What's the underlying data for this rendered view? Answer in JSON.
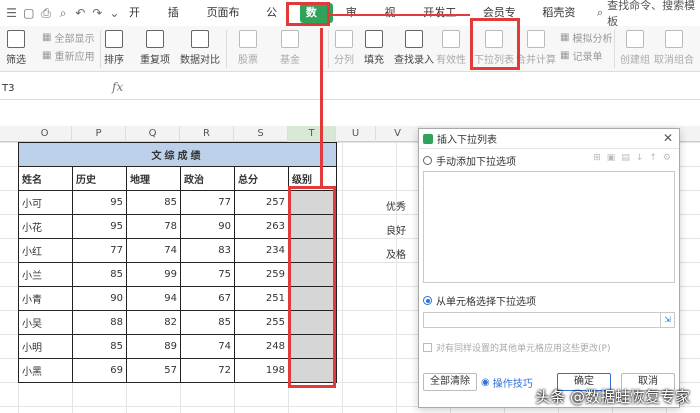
{
  "menu": {
    "tabs": [
      "开始",
      "插入",
      "页面布局",
      "公式",
      "数据",
      "审阅",
      "视图",
      "开发工具",
      "会员专享",
      "稻壳资源"
    ],
    "active_tab": "数据",
    "search": "查找命令、搜索模板"
  },
  "toolbar": {
    "show_all": "全部显示",
    "filter": "筛选",
    "reapply": "重新应用",
    "sort": "排序",
    "duplicate": "重复项",
    "compare": "数据对比",
    "stock": "股票",
    "fund": "基金",
    "split": "分列",
    "fill": "填充",
    "lookup": "查找录入",
    "validity": "有效性",
    "dropdown": "下拉列表",
    "consolidate": "合并计算",
    "simulate": "模拟分析",
    "record": "记录单",
    "group": "创建组",
    "ungroup": "取消组合"
  },
  "formula_bar": {
    "name_box": "T3",
    "fx": "fx"
  },
  "columns": [
    "O",
    "P",
    "Q",
    "R",
    "S",
    "T",
    "U",
    "V"
  ],
  "selected_column": "T",
  "table": {
    "title": "文综成绩",
    "headers": [
      "姓名",
      "历史",
      "地理",
      "政治",
      "总分",
      "级别"
    ],
    "rows": [
      [
        "小可",
        "95",
        "85",
        "77",
        "257"
      ],
      [
        "小花",
        "95",
        "78",
        "90",
        "263"
      ],
      [
        "小红",
        "77",
        "74",
        "83",
        "234"
      ],
      [
        "小兰",
        "85",
        "99",
        "75",
        "259"
      ],
      [
        "小青",
        "90",
        "94",
        "67",
        "251"
      ],
      [
        "小吴",
        "88",
        "82",
        "85",
        "255"
      ],
      [
        "小明",
        "85",
        "89",
        "74",
        "248"
      ],
      [
        "小黑",
        "69",
        "57",
        "72",
        "198"
      ]
    ]
  },
  "side_labels": [
    "优秀",
    "良好",
    "及格"
  ],
  "dialog": {
    "title": "插入下拉列表",
    "option_manual": "手动添加下拉选项",
    "option_cells": "从单元格选择下拉选项",
    "apply_same": "对有同样设置的其他单元格应用这些更改(P)",
    "clear_all": "全部清除",
    "tips": "操作技巧",
    "ok": "确定",
    "cancel": "取消"
  },
  "watermark": "头条 @数据蛙恢复专家"
}
